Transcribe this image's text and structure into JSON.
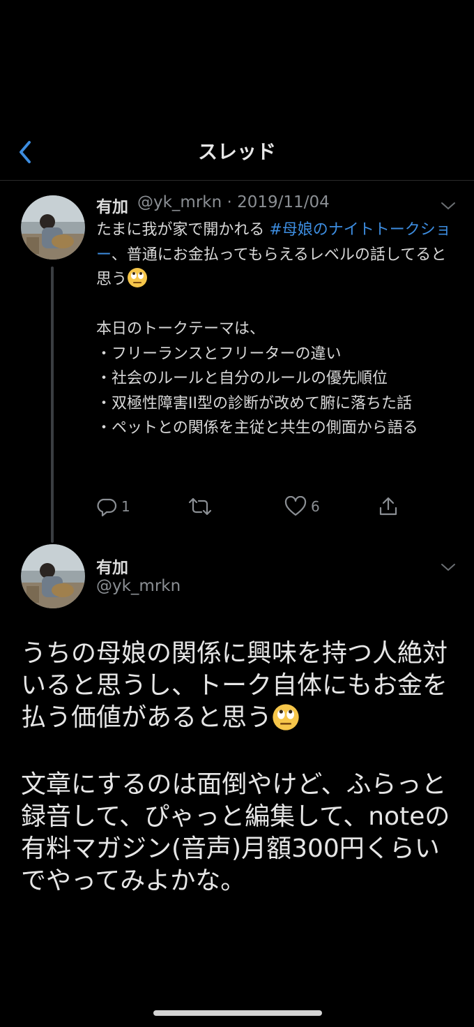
{
  "header": {
    "title": "スレッド"
  },
  "tweet1": {
    "name": "有加",
    "handle": "@yk_mrkn",
    "date_sep": " · ",
    "date": "2019/11/04",
    "text_pre": "たまに我が家で開かれる ",
    "hashtag": "#母娘のナイトトークショー",
    "text_post": "、普通にお金払ってもらえるレベルの話してると思う",
    "body": "本日のトークテーマは、\n・フリーランスとフリーターの違い\n・社会のルールと自分のルールの優先順位\n・双極性障害II型の診断が改めて腑に落ちた話\n・ペットとの関係を主従と共生の側面から語る",
    "reply_count": "1",
    "like_count": "6",
    "emoji": "face-with-rolling-eyes-emoji"
  },
  "tweet2": {
    "name": "有加",
    "handle": "@yk_mrkn",
    "para1": "うちの母娘の関係に興味を持つ人絶対いると思うし、トーク自体にもお金を払う価値があると思う",
    "para2": "文章にするのは面倒やけど、ふらっと録音して、ぴゃっと編集して、noteの有料マガジン(音声)月額300円くらいでやってみよかな。",
    "emoji": "face-with-rolling-eyes-emoji"
  },
  "icons": [
    "back-chevron-icon",
    "caret-down-icon",
    "reply-icon",
    "retweet-icon",
    "like-icon",
    "share-icon"
  ],
  "colors": {
    "background": "#000000",
    "accent": "#3d8de0",
    "secondary": "#8b8f94"
  }
}
